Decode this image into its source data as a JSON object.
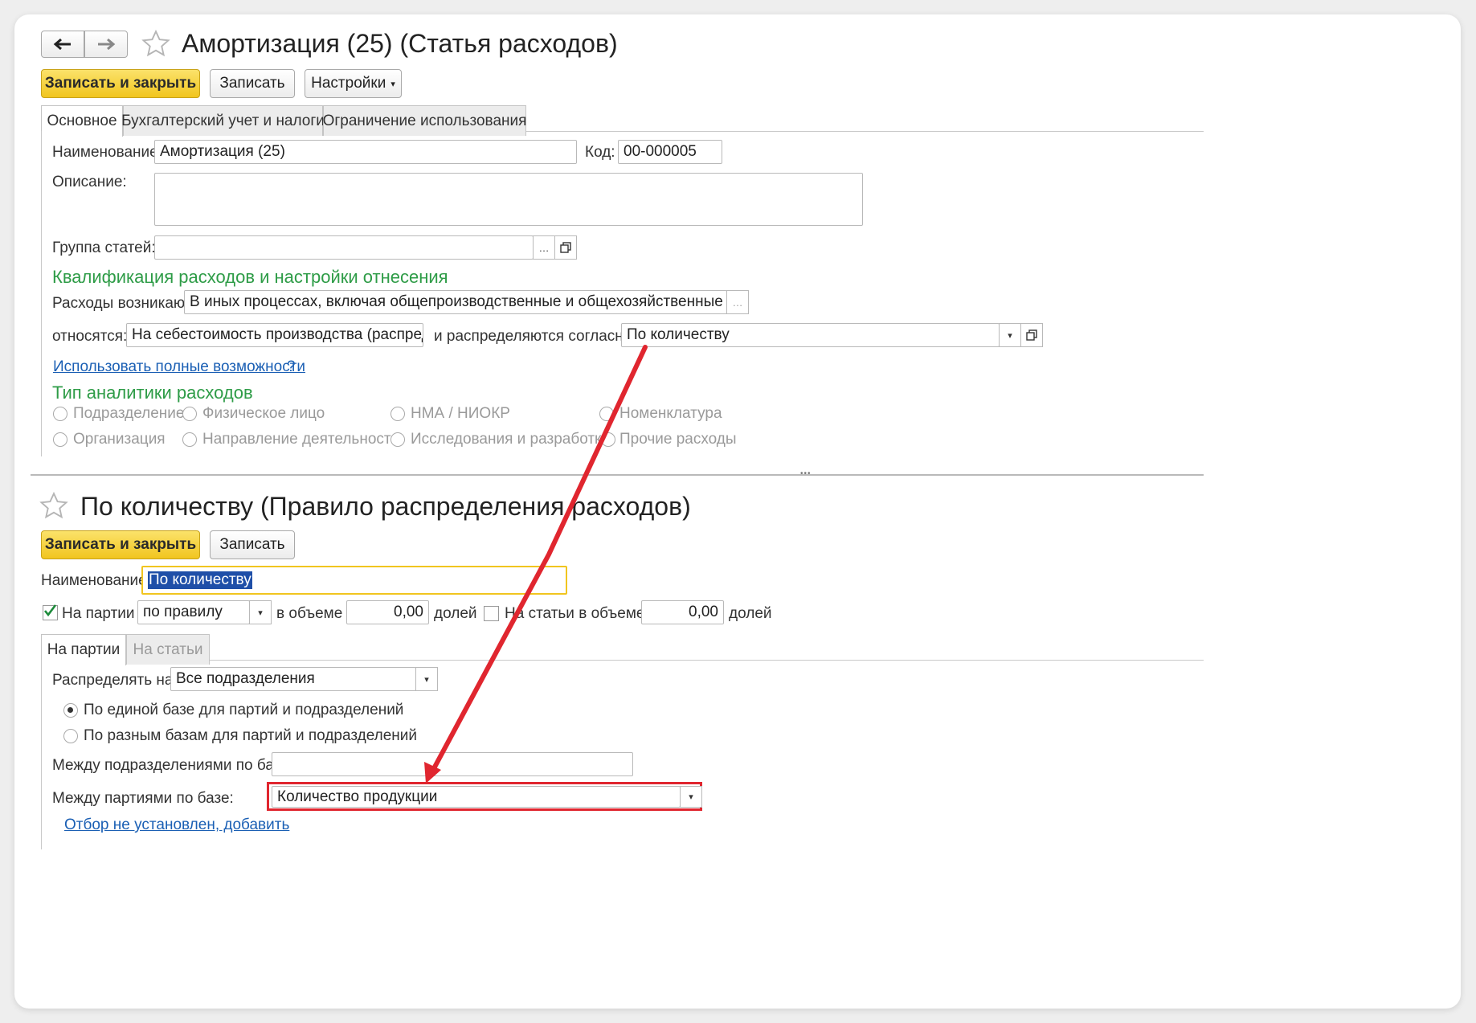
{
  "window1": {
    "nav": {
      "back_icon": "arrow-left-icon",
      "forward_icon": "arrow-right-icon"
    },
    "favorite_icon": "star-icon",
    "title": "Амортизация (25) (Статья расходов)",
    "toolbar": {
      "save_close": "Записать и закрыть",
      "save": "Записать",
      "settings": "Настройки"
    },
    "tabs": [
      "Основное",
      "Бухгалтерский учет и налоги",
      "Ограничение использования"
    ],
    "form": {
      "name_label": "Наименование:",
      "name_value": "Амортизация (25)",
      "code_label": "Код:",
      "code_value": "00-000005",
      "description_label": "Описание:",
      "group_label": "Группа статей:",
      "group_value": ""
    },
    "qualification": {
      "heading": "Квалификация расходов и настройки отнесения",
      "arise_label": "Расходы возникают:",
      "arise_value": "В иных процессах, включая общепроизводственные и общехозяйственные",
      "relate_label": "относятся:",
      "relate_value": "На себестоимость производства (распределя",
      "distribute_label": "и распределяются согласно:",
      "distribute_value": "По количеству"
    },
    "full_link": "Использовать полные возможности",
    "help": "?",
    "analytics": {
      "heading": "Тип аналитики расходов",
      "options": [
        "Подразделение",
        "Физическое лицо",
        "НМА / НИОКР",
        "Номенклатура",
        "Организация",
        "Направление деятельности",
        "Исследования и разработки",
        "Прочие расходы"
      ]
    }
  },
  "splitter_dots": "•••",
  "window2": {
    "title": "По количеству (Правило распределения расходов)",
    "toolbar": {
      "save_close": "Записать и закрыть",
      "save": "Записать"
    },
    "name_label": "Наименование:",
    "name_value": "По количеству",
    "batches_label": "На партии",
    "batches_checked": true,
    "batches_rule": "по правилу",
    "volume_label": "в объеме",
    "volume_value": "0,00",
    "shares_label": "долей",
    "items_label": "На статьи в объеме",
    "items_checked": false,
    "items_value": "0,00",
    "items_shares_label": "долей",
    "tabs": [
      "На партии",
      "На статьи"
    ],
    "distribute_label": "Распределять на:",
    "distribute_value": "Все подразделения",
    "radio_options": [
      "По единой базе для партий и подразделений",
      "По разным базам для партий и подразделений"
    ],
    "radio_selected": 0,
    "between_depts_label": "Между подразделениями по базе:",
    "between_depts_value": "",
    "between_batches_label": "Между партиями по базе:",
    "between_batches_value": "Количество продукции",
    "filter_link": "Отбор не установлен, добавить"
  },
  "annotation": {
    "highlight_color": "#e0262f",
    "accent_yellow": "#f1c51f",
    "section_green": "#2e9c47",
    "link_blue": "#1a5fb4"
  }
}
